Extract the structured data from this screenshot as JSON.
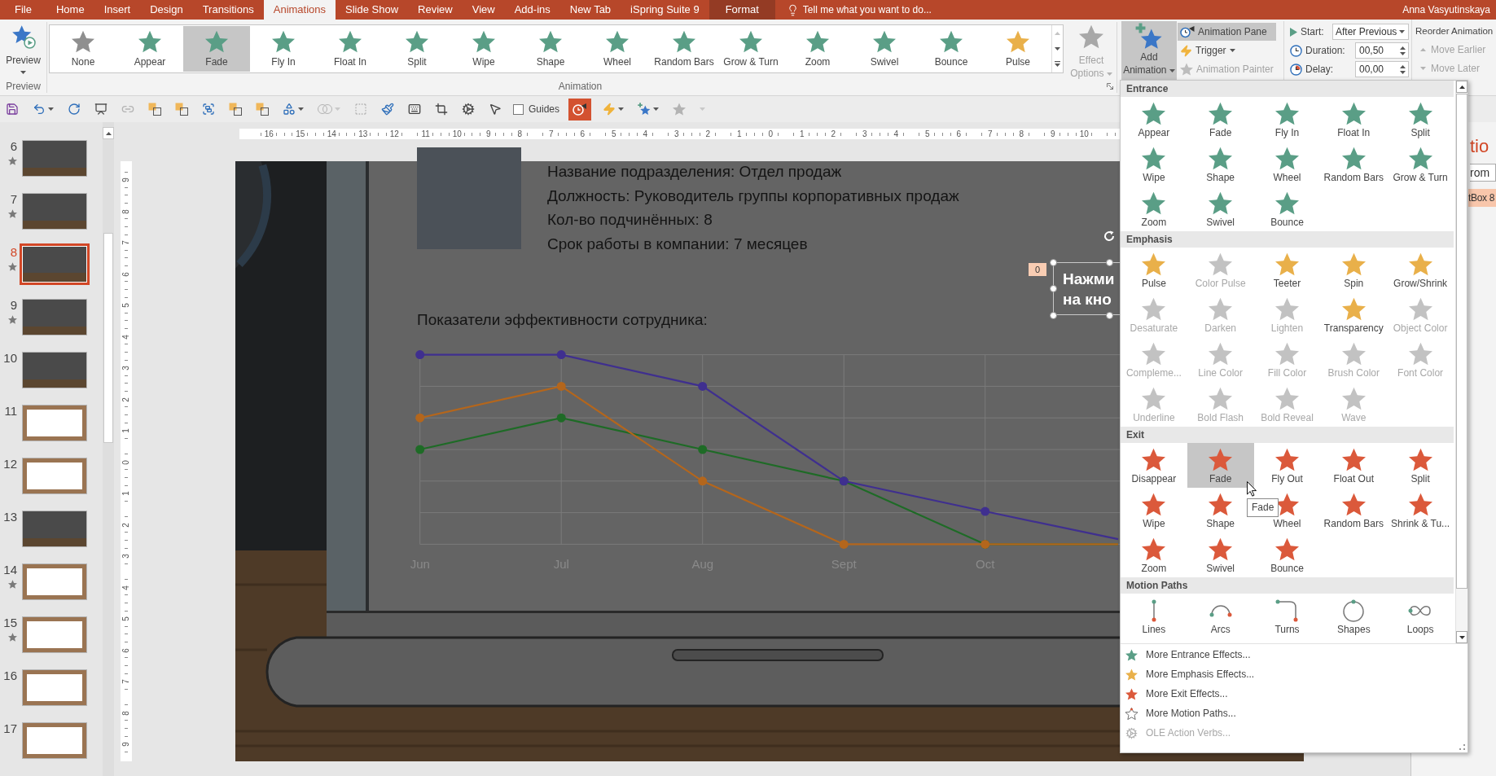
{
  "tabs": [
    {
      "label": "File",
      "kind": "file",
      "selected": false
    },
    {
      "label": "Home",
      "kind": "main",
      "selected": false
    },
    {
      "label": "Insert",
      "kind": "main",
      "selected": false
    },
    {
      "label": "Design",
      "kind": "main",
      "selected": false
    },
    {
      "label": "Transitions",
      "kind": "main",
      "selected": false
    },
    {
      "label": "Animations",
      "kind": "main",
      "selected": true
    },
    {
      "label": "Slide Show",
      "kind": "main",
      "selected": false
    },
    {
      "label": "Review",
      "kind": "main",
      "selected": false
    },
    {
      "label": "View",
      "kind": "main",
      "selected": false
    },
    {
      "label": "Add-ins",
      "kind": "main",
      "selected": false
    },
    {
      "label": "New Tab",
      "kind": "main",
      "selected": false
    },
    {
      "label": "iSpring Suite 9",
      "kind": "main",
      "selected": false
    },
    {
      "label": "Format",
      "kind": "contextual",
      "selected": false
    }
  ],
  "tell_me": {
    "placeholder": "Tell me what you want to do..."
  },
  "user": "Anna Vasyutinskaya",
  "ribbon": {
    "preview": {
      "label": "Preview",
      "group": "Preview"
    },
    "gallery": {
      "group": "Animation",
      "items": [
        {
          "label": "None",
          "kind": "none",
          "selected": false
        },
        {
          "label": "Appear",
          "kind": "entrance",
          "selected": false
        },
        {
          "label": "Fade",
          "kind": "entrance",
          "selected": true
        },
        {
          "label": "Fly In",
          "kind": "entrance",
          "selected": false
        },
        {
          "label": "Float In",
          "kind": "entrance",
          "selected": false
        },
        {
          "label": "Split",
          "kind": "entrance",
          "selected": false
        },
        {
          "label": "Wipe",
          "kind": "entrance",
          "selected": false
        },
        {
          "label": "Shape",
          "kind": "entrance",
          "selected": false
        },
        {
          "label": "Wheel",
          "kind": "entrance",
          "selected": false
        },
        {
          "label": "Random Bars",
          "kind": "entrance",
          "selected": false
        },
        {
          "label": "Grow & Turn",
          "kind": "entrance",
          "selected": false
        },
        {
          "label": "Zoom",
          "kind": "entrance",
          "selected": false
        },
        {
          "label": "Swivel",
          "kind": "entrance",
          "selected": false
        },
        {
          "label": "Bounce",
          "kind": "entrance",
          "selected": false
        },
        {
          "label": "Pulse",
          "kind": "emphasis",
          "selected": false
        }
      ]
    },
    "effect_options": {
      "label": "Effect Options",
      "disabled": true
    },
    "add_animation": {
      "label": "Add Animation",
      "expanded": true
    },
    "commands": [
      {
        "label": "Animation Pane",
        "kind": "pane",
        "on": true,
        "disabled": false,
        "dropdown": false
      },
      {
        "label": "Trigger",
        "kind": "trigger",
        "on": false,
        "disabled": false,
        "dropdown": true
      },
      {
        "label": "Animation Painter",
        "kind": "painter",
        "on": false,
        "disabled": true,
        "dropdown": false
      }
    ],
    "timing": [
      {
        "label": "Start:",
        "kind": "select",
        "value": "After Previous"
      },
      {
        "label": "Duration:",
        "kind": "spin",
        "value": "00,50"
      },
      {
        "label": "Delay:",
        "kind": "spin",
        "value": "00,00"
      }
    ],
    "reorder": {
      "title": "Reorder Animation",
      "items": [
        {
          "label": "Move Earlier",
          "kind": "earlier",
          "disabled": true
        },
        {
          "label": "Move Later",
          "kind": "later",
          "disabled": true
        }
      ]
    }
  },
  "quick_access": {
    "left": [
      {
        "kind": "save",
        "dropdown": false,
        "disabled": false,
        "on": false
      },
      {
        "kind": "undo",
        "dropdown": true,
        "disabled": false,
        "on": false
      },
      {
        "kind": "repeat",
        "dropdown": false,
        "disabled": false,
        "on": false
      },
      {
        "kind": "from_start",
        "dropdown": false,
        "disabled": false,
        "on": false
      },
      {
        "kind": "link",
        "dropdown": false,
        "disabled": true,
        "on": false
      },
      {
        "kind": "bring_forward",
        "dropdown": false,
        "disabled": false,
        "on": false
      },
      {
        "kind": "send_backward",
        "dropdown": false,
        "disabled": false,
        "on": false
      },
      {
        "kind": "group",
        "dropdown": false,
        "disabled": false,
        "on": false
      },
      {
        "kind": "align",
        "dropdown": false,
        "disabled": false,
        "on": false
      },
      {
        "kind": "arrange",
        "dropdown": false,
        "disabled": false,
        "on": false
      },
      {
        "kind": "shapes",
        "dropdown": true,
        "disabled": false,
        "on": false
      },
      {
        "kind": "merge",
        "dropdown": true,
        "disabled": true,
        "on": false
      },
      {
        "kind": "select",
        "dropdown": false,
        "disabled": true,
        "on": false
      },
      {
        "kind": "painter",
        "dropdown": false,
        "disabled": false,
        "on": false
      },
      {
        "kind": "keyboard",
        "dropdown": false,
        "disabled": false,
        "on": false
      },
      {
        "kind": "crop",
        "dropdown": false,
        "disabled": false,
        "on": false
      },
      {
        "kind": "gears",
        "dropdown": false,
        "disabled": false,
        "on": false
      },
      {
        "kind": "selection_pane",
        "dropdown": false,
        "disabled": false,
        "on": false
      }
    ],
    "guides": {
      "label": "Guides",
      "checked": false
    },
    "right": [
      {
        "kind": "timer",
        "dropdown": false,
        "disabled": false,
        "on": true
      },
      {
        "kind": "lightning",
        "dropdown": true,
        "disabled": false,
        "on": false
      },
      {
        "kind": "star_plus",
        "dropdown": true,
        "disabled": false,
        "on": false
      },
      {
        "kind": "star",
        "dropdown": false,
        "disabled": true,
        "on": false
      },
      {
        "kind": "more",
        "dropdown": true,
        "disabled": true,
        "on": false
      }
    ]
  },
  "slides": [
    {
      "number": "6",
      "kind": "dark",
      "animated": true,
      "selected": false
    },
    {
      "number": "7",
      "kind": "dark",
      "animated": true,
      "selected": false
    },
    {
      "number": "8",
      "kind": "dark",
      "animated": true,
      "selected": true
    },
    {
      "number": "9",
      "kind": "dark",
      "animated": true,
      "selected": false
    },
    {
      "number": "10",
      "kind": "dark",
      "animated": false,
      "selected": false
    },
    {
      "number": "11",
      "kind": "light",
      "animated": false,
      "selected": false
    },
    {
      "number": "12",
      "kind": "light",
      "animated": false,
      "selected": false
    },
    {
      "number": "13",
      "kind": "dark",
      "animated": false,
      "selected": false
    },
    {
      "number": "14",
      "kind": "light",
      "animated": true,
      "selected": false
    },
    {
      "number": "15",
      "kind": "light",
      "animated": true,
      "selected": false
    },
    {
      "number": "16",
      "kind": "light",
      "animated": false,
      "selected": false
    },
    {
      "number": "17",
      "kind": "light",
      "animated": false,
      "selected": false
    }
  ],
  "rulers": {
    "horizontal": [
      "16",
      "15",
      "14",
      "13",
      "12",
      "11",
      "10",
      "9",
      "8",
      "7",
      "6",
      "5",
      "4",
      "3",
      "2",
      "1",
      "0",
      "1",
      "2",
      "3",
      "4",
      "5",
      "6",
      "7",
      "8",
      "9",
      "10"
    ],
    "vertical": [
      "9",
      "8",
      "7",
      "6",
      "5",
      "4",
      "3",
      "2",
      "1",
      "0",
      "1",
      "2",
      "3",
      "4",
      "5",
      "6",
      "7",
      "8",
      "9"
    ]
  },
  "slide": {
    "info": [
      "Название подразделения: Отдел продаж",
      "Должность: Руководитель группы корпоративных продаж",
      "Кол-во подчинённых: 8",
      "Срок работы в компании: 7 месяцев"
    ],
    "chart_title": "Показатели эффективности сотрудника:",
    "chart": {
      "x_labels": [
        "Jun",
        "Jul",
        "Aug",
        "Sept",
        "Oct"
      ]
    },
    "text_box": {
      "lines": [
        "Нажми",
        "на кно"
      ],
      "badge": "0",
      "selected": true
    }
  },
  "animation_menu": {
    "sections": [
      {
        "title": "Entrance",
        "kind": "entrance",
        "items": [
          {
            "label": "Appear",
            "selected": false
          },
          {
            "label": "Fade",
            "selected": false
          },
          {
            "label": "Fly In",
            "selected": false
          },
          {
            "label": "Float In",
            "selected": false
          },
          {
            "label": "Split",
            "selected": false
          },
          {
            "label": "Wipe",
            "selected": false
          },
          {
            "label": "Shape",
            "selected": false
          },
          {
            "label": "Wheel",
            "selected": false
          },
          {
            "label": "Random Bars",
            "selected": false
          },
          {
            "label": "Grow & Turn",
            "selected": false
          },
          {
            "label": "Zoom",
            "selected": false
          },
          {
            "label": "Swivel",
            "selected": false
          },
          {
            "label": "Bounce",
            "selected": false
          }
        ]
      },
      {
        "title": "Emphasis",
        "kind": "emphasis",
        "items": [
          {
            "label": "Pulse",
            "disabled": false,
            "selected": false
          },
          {
            "label": "Color Pulse",
            "disabled": true,
            "selected": false
          },
          {
            "label": "Teeter",
            "disabled": false,
            "selected": false
          },
          {
            "label": "Spin",
            "disabled": false,
            "selected": false
          },
          {
            "label": "Grow/Shrink",
            "disabled": false,
            "selected": false
          },
          {
            "label": "Desaturate",
            "disabled": true,
            "selected": false
          },
          {
            "label": "Darken",
            "disabled": true,
            "selected": false
          },
          {
            "label": "Lighten",
            "disabled": true,
            "selected": false
          },
          {
            "label": "Transparency",
            "disabled": false,
            "selected": false
          },
          {
            "label": "Object Color",
            "disabled": true,
            "selected": false
          },
          {
            "label": "Compleme...",
            "disabled": true,
            "selected": false
          },
          {
            "label": "Line Color",
            "disabled": true,
            "selected": false
          },
          {
            "label": "Fill Color",
            "disabled": true,
            "selected": false
          },
          {
            "label": "Brush Color",
            "disabled": true,
            "selected": false
          },
          {
            "label": "Font Color",
            "disabled": true,
            "selected": false
          },
          {
            "label": "Underline",
            "disabled": true,
            "selected": false
          },
          {
            "label": "Bold Flash",
            "disabled": true,
            "selected": false
          },
          {
            "label": "Bold Reveal",
            "disabled": true,
            "selected": false
          },
          {
            "label": "Wave",
            "disabled": true,
            "selected": false
          }
        ]
      },
      {
        "title": "Exit",
        "kind": "exit",
        "items": [
          {
            "label": "Disappear",
            "selected": false
          },
          {
            "label": "Fade",
            "selected": true
          },
          {
            "label": "Fly Out",
            "selected": false
          },
          {
            "label": "Float Out",
            "selected": false
          },
          {
            "label": "Split",
            "selected": false
          },
          {
            "label": "Wipe",
            "selected": false
          },
          {
            "label": "Shape",
            "selected": false
          },
          {
            "label": "Wheel",
            "selected": false
          },
          {
            "label": "Random Bars",
            "selected": false
          },
          {
            "label": "Shrink & Tu...",
            "selected": false
          },
          {
            "label": "Zoom",
            "selected": false
          },
          {
            "label": "Swivel",
            "selected": false
          },
          {
            "label": "Bounce",
            "selected": false
          }
        ]
      },
      {
        "title": "Motion Paths",
        "kind": "motion",
        "items": [
          {
            "label": "Lines",
            "selected": false
          },
          {
            "label": "Arcs",
            "selected": false
          },
          {
            "label": "Turns",
            "selected": false
          },
          {
            "label": "Shapes",
            "selected": false
          },
          {
            "label": "Loops",
            "selected": false
          }
        ]
      }
    ],
    "tooltip": "Fade",
    "commands": [
      {
        "label": "More Entrance Effects...",
        "kind": "entrance",
        "disabled": false
      },
      {
        "label": "More Emphasis Effects...",
        "kind": "emphasis",
        "disabled": false
      },
      {
        "label": "More Exit Effects...",
        "kind": "exit",
        "disabled": false
      },
      {
        "label": "More Motion Paths...",
        "kind": "motion",
        "disabled": false
      },
      {
        "label": "OLE Action Verbs...",
        "kind": "verbs",
        "disabled": true
      }
    ]
  },
  "animation_pane": {
    "title": "tio",
    "play": "rom",
    "items": [
      {
        "label": "tBox 8",
        "selected": true
      }
    ]
  }
}
